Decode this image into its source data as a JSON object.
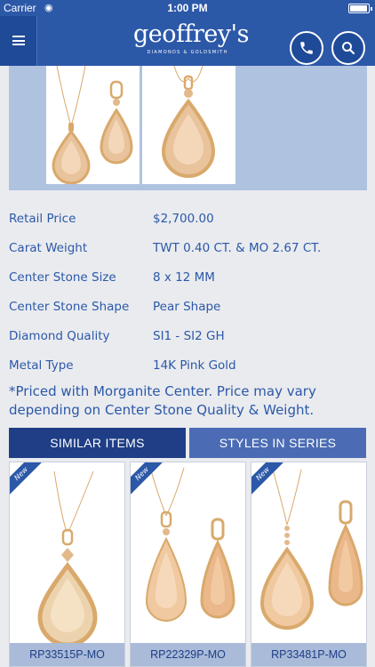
{
  "status_bar": {
    "carrier": "Carrier",
    "time": "1:00 PM"
  },
  "header": {
    "logo_name": "geoffrey's",
    "logo_tagline": "DIAMONDS & GOLDSMITH"
  },
  "specs": [
    {
      "label": "Retail Price",
      "value": "$2,700.00"
    },
    {
      "label": "Carat Weight",
      "value": "TWT 0.40 CT. & MO 2.67 CT."
    },
    {
      "label": "Center Stone Size",
      "value": "8 x 12 MM"
    },
    {
      "label": "Center Stone Shape",
      "value": "Pear Shape"
    },
    {
      "label": "Diamond Quality",
      "value": "SI1 - SI2 GH"
    },
    {
      "label": "Metal Type",
      "value": "14K Pink Gold"
    }
  ],
  "note": "*Priced with Morganite Center. Price may vary depending on Center Stone Quality & Weight.",
  "tabs": {
    "similar": "SIMILAR ITEMS",
    "series": "STYLES IN SERIES"
  },
  "products": [
    {
      "badge": "New",
      "sku": "RP33515P-MO"
    },
    {
      "badge": "New",
      "sku": "RP22329P-MO"
    },
    {
      "badge": "New",
      "sku": "RP33481P-MO"
    }
  ],
  "colors": {
    "brand_blue": "#2c58a8",
    "dark_blue": "#1f3e86",
    "light_blue": "#afc2e0",
    "gold": "#d9a96c",
    "morganite": "#f0c9a0"
  },
  "icons": {
    "menu": "hamburger-icon",
    "phone": "phone-icon",
    "search": "search-icon",
    "wifi": "wifi-icon",
    "battery": "battery-icon"
  }
}
